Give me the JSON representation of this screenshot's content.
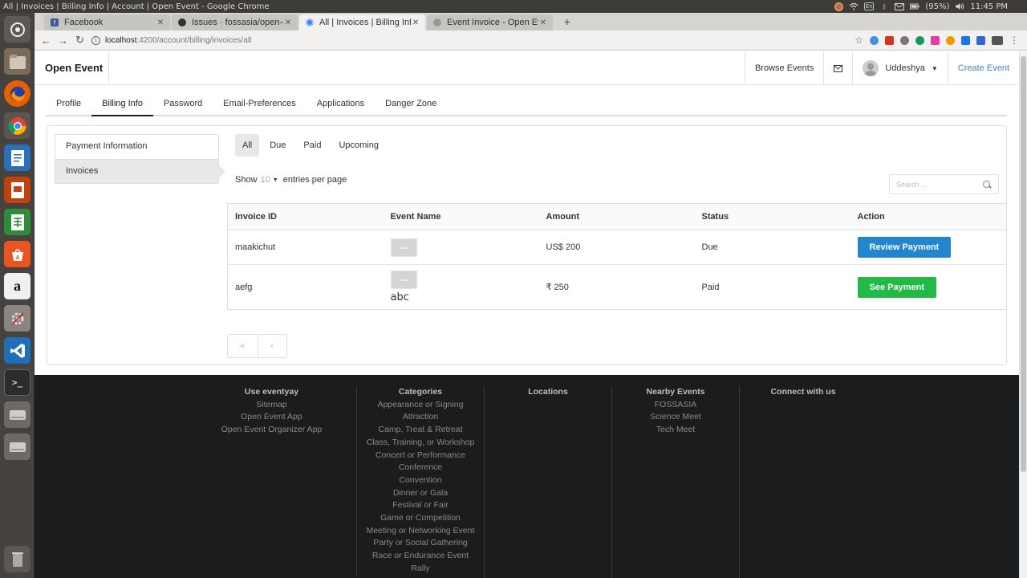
{
  "os": {
    "window_title": "All | Invoices | Billing Info | Account | Open Event - Google Chrome",
    "input_method": "En",
    "battery": "(95%)",
    "clock": "11:45 PM"
  },
  "tabs": [
    {
      "label": "Facebook",
      "favicon_color": "#3b5998",
      "favicon_glyph": "f"
    },
    {
      "label": "Issues · fossasia/open-ev",
      "favicon_color": "#333333",
      "favicon_glyph": ""
    },
    {
      "label": "All | Invoices | Billing Info",
      "favicon_color": "#4285f4",
      "favicon_glyph": ""
    },
    {
      "label": "Event Invoice - Open Eve",
      "favicon_color": "#999999",
      "favicon_glyph": ""
    }
  ],
  "address": {
    "host": "localhost",
    "path": ":4200/account/billing/invoices/all"
  },
  "nav": {
    "brand": "Open Event",
    "browse": "Browse Events",
    "user": "Uddeshya",
    "create": "Create Event"
  },
  "account_tabs": [
    "Profile",
    "Billing Info",
    "Password",
    "Email-Preferences",
    "Applications",
    "Danger Zone"
  ],
  "side_menu": [
    "Payment Information",
    "Invoices"
  ],
  "status_tabs": [
    "All",
    "Due",
    "Paid",
    "Upcoming"
  ],
  "entries": {
    "prefix": "Show",
    "value": "10",
    "suffix": "entries per page"
  },
  "search": {
    "placeholder": "Search ..."
  },
  "table": {
    "headers": [
      "Invoice ID",
      "Event Name",
      "Amount",
      "Status",
      "Action"
    ],
    "rows": [
      {
        "id": "maakichut",
        "event": "",
        "amount": "US$ 200",
        "status": "Due",
        "action": "Review Payment"
      },
      {
        "id": "aefg",
        "event": "abc",
        "amount": "₹ 250",
        "status": "Paid",
        "action": "See Payment"
      }
    ]
  },
  "pager": {
    "first": "«",
    "prev": "‹"
  },
  "footer": {
    "use": {
      "title": "Use eventyay",
      "links": [
        "Sitemap",
        "Open Event App",
        "Open Event Organizer App"
      ]
    },
    "categories": {
      "title": "Categories",
      "links": [
        "Appearance or Signing",
        "Attraction",
        "Camp, Treat & Retreat",
        "Class, Training, or Workshop",
        "Concert or Performance",
        "Conference",
        "Convention",
        "Dinner or Gala",
        "Festival or Fair",
        "Game or Competition",
        "Meeting or Networking Event",
        "Party or Social Gathering",
        "Race or Endurance Event",
        "Rally"
      ]
    },
    "locations": {
      "title": "Locations"
    },
    "nearby": {
      "title": "Nearby Events",
      "links": [
        "FOSSASIA",
        "Science Meet",
        "Tech Meet"
      ]
    },
    "connect": {
      "title": "Connect with us"
    }
  },
  "colors": {
    "primary_button": "#2185d0",
    "success_button": "#21ba45",
    "link": "#4183c4",
    "footer_bg": "#1b1c1d"
  }
}
